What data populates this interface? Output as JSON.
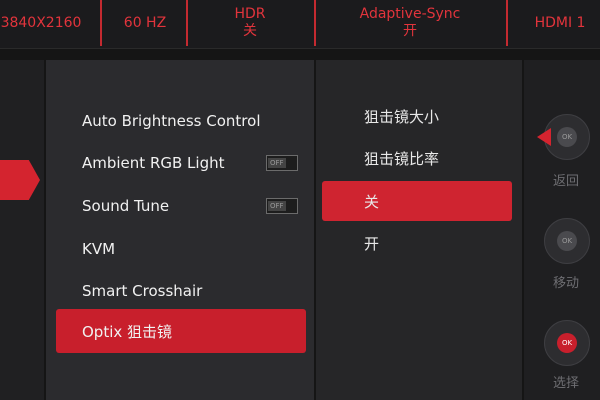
{
  "status_bar": {
    "resolution": "3840X2160",
    "refresh_rate": "60 HZ",
    "hdr_label": "HDR",
    "hdr_value": "关",
    "adaptive_sync_label": "Adaptive-Sync",
    "adaptive_sync_value": "开",
    "input": "HDMI 1"
  },
  "menu": {
    "items": [
      {
        "label": "Auto Brightness Control"
      },
      {
        "label": "Ambient RGB Light",
        "toggle": "OFF"
      },
      {
        "label": "Sound Tune",
        "toggle": "OFF"
      },
      {
        "label": "KVM"
      },
      {
        "label": "Smart Crosshair"
      },
      {
        "label": "Optix 狙击镜",
        "selected": true
      }
    ]
  },
  "submenu": {
    "items": [
      {
        "label": "狙击镜大小"
      },
      {
        "label": "狙击镜比率"
      },
      {
        "label": "关",
        "selected": true
      },
      {
        "label": "开"
      }
    ]
  },
  "controls": {
    "ok": "OK",
    "back": "返回",
    "move": "移动",
    "select": "选择"
  },
  "colors": {
    "accent": "#c81f2c",
    "status_text": "#e2343c",
    "panel": "#2b2b2e"
  }
}
